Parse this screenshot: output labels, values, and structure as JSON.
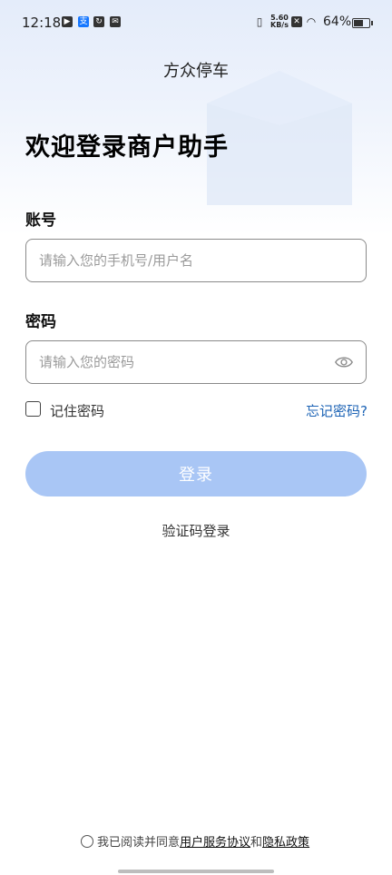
{
  "status_bar": {
    "time": "12:18",
    "net_speed": "5.60",
    "net_unit": "KB/s",
    "battery": "64%",
    "battery_level": 0.64
  },
  "app": {
    "title": "方众停车"
  },
  "main": {
    "heading": "欢迎登录商户助手",
    "account": {
      "label": "账号",
      "placeholder": "请输入您的手机号/用户名",
      "value": ""
    },
    "password": {
      "label": "密码",
      "placeholder": "请输入您的密码",
      "value": ""
    },
    "remember_label": "记住密码",
    "forgot_label": "忘记密码?",
    "login_label": "登录",
    "sms_login_label": "验证码登录"
  },
  "footer": {
    "agree_prefix": "我已阅读并同意",
    "terms": "用户服务协议",
    "and": "和",
    "privacy": "隐私政策"
  },
  "colors": {
    "accent": "#1c63b5",
    "button": "#a9c6f5",
    "bg_top": "#e4ecfa"
  }
}
